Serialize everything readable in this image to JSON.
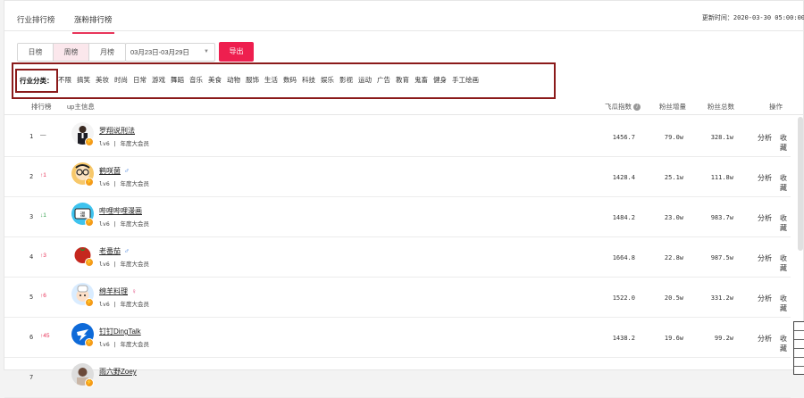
{
  "tabs": [
    {
      "label": "行业排行榜",
      "active": false
    },
    {
      "label": "涨粉排行榜",
      "active": true
    }
  ],
  "update_time": "更新时间：2020-03-30 05:00:00",
  "period": {
    "options": [
      "日榜",
      "周榜",
      "月榜"
    ],
    "selected": "周榜"
  },
  "date_range": "03月23日-03月29日",
  "export_label": "导出",
  "category": {
    "label": "行业分类：",
    "items": [
      "不限",
      "搞笑",
      "美妆",
      "时尚",
      "日常",
      "游戏",
      "舞蹈",
      "音乐",
      "美食",
      "动物",
      "服饰",
      "生活",
      "数码",
      "科技",
      "娱乐",
      "影视",
      "运动",
      "广告",
      "教育",
      "鬼畜",
      "健身",
      "手工绘画"
    ]
  },
  "table": {
    "headers": {
      "rank": "排行榜",
      "info": "up主信息",
      "index": "飞瓜指数",
      "fans_inc": "粉丝增量",
      "fans_total": "粉丝总数",
      "ops": "操作"
    },
    "ops_labels": {
      "analyze": "分析",
      "collect": "收藏"
    },
    "rows": [
      {
        "rank": "1",
        "trend": "—",
        "trend_dir": "flat",
        "name": "罗翔说刑法",
        "gender": "",
        "level": "lv6",
        "vip": "年度大会员",
        "index": "1456.7",
        "fans_inc": "79.0w",
        "fans_total": "328.1w",
        "avatar": "suit-person"
      },
      {
        "rank": "2",
        "trend": "↑1",
        "trend_dir": "up",
        "name": "鹤咲菌",
        "gender": "♂",
        "gender_kind": "male",
        "level": "lv6",
        "vip": "年度大会员",
        "index": "1428.4",
        "fans_inc": "25.1w",
        "fans_total": "111.8w",
        "avatar": "cartoon-glasses"
      },
      {
        "rank": "3",
        "trend": "↓1",
        "trend_dir": "down",
        "name": "哔哩哔哩漫画",
        "gender": "",
        "level": "lv6",
        "vip": "年度大会员",
        "index": "1484.2",
        "fans_inc": "23.0w",
        "fans_total": "983.7w",
        "avatar": "comic-logo"
      },
      {
        "rank": "4",
        "trend": "↑3",
        "trend_dir": "up",
        "name": "老番茄",
        "gender": "♂",
        "gender_kind": "male",
        "level": "lv6",
        "vip": "年度大会员",
        "index": "1664.8",
        "fans_inc": "22.8w",
        "fans_total": "987.5w",
        "avatar": "tomato"
      },
      {
        "rank": "5",
        "trend": "↑6",
        "trend_dir": "up",
        "name": "绵羊料理",
        "gender": "♀",
        "gender_kind": "female",
        "level": "lv6",
        "vip": "年度大会员",
        "index": "1522.0",
        "fans_inc": "20.5w",
        "fans_total": "331.2w",
        "avatar": "chef-cartoon"
      },
      {
        "rank": "6",
        "trend": "↑45",
        "trend_dir": "up",
        "name": "钉钉DingTalk",
        "gender": "",
        "level": "lv6",
        "vip": "年度大会员",
        "index": "1438.2",
        "fans_inc": "19.6w",
        "fans_total": "99.2w",
        "avatar": "dingtalk"
      },
      {
        "rank": "7",
        "trend": "",
        "trend_dir": "flat",
        "name": "雨六野Zoey",
        "gender": "",
        "level": "",
        "vip": "",
        "index": "",
        "fans_inc": "",
        "fans_total": "",
        "avatar": "person"
      }
    ]
  },
  "colors": {
    "accent": "#ee1f4f",
    "highlight_box": "#8b1a1a",
    "badge": "#f49a1a"
  }
}
